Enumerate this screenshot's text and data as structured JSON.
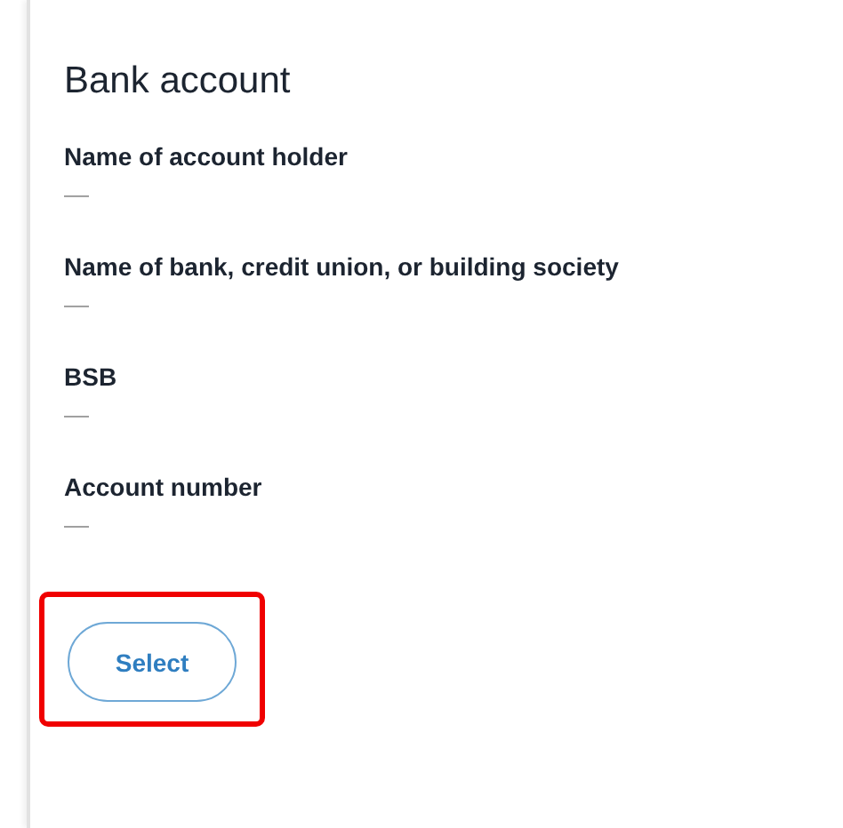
{
  "title": "Bank account",
  "fields": [
    {
      "label": "Name of account holder",
      "value": "—"
    },
    {
      "label": "Name of bank, credit union, or building society",
      "value": "—"
    },
    {
      "label": "BSB",
      "value": "—"
    },
    {
      "label": "Account number",
      "value": "—"
    }
  ],
  "button": {
    "label": "Select",
    "highlighted": true
  }
}
